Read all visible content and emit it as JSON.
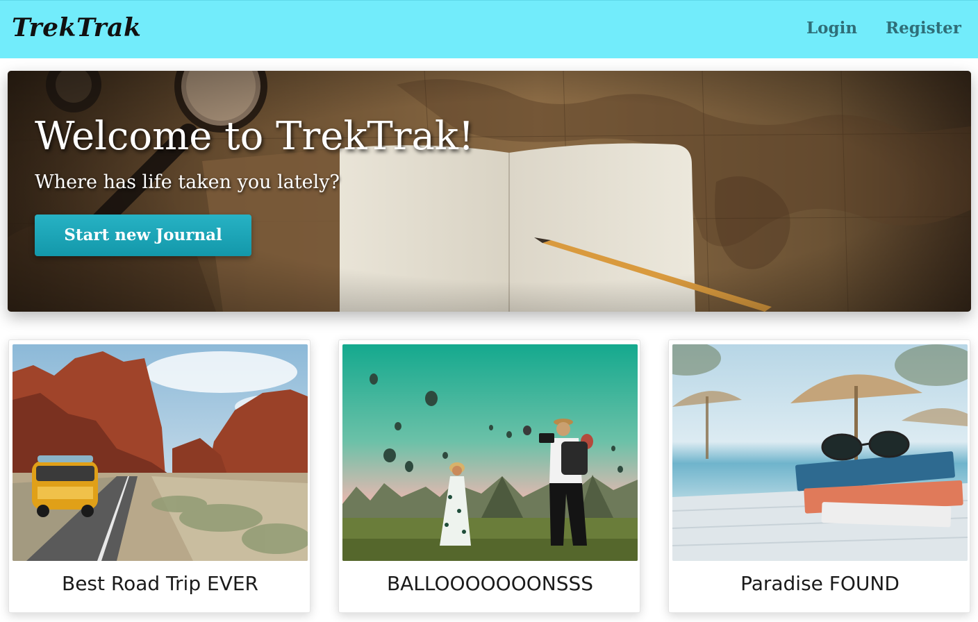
{
  "navbar": {
    "brand": "TrekTrak",
    "links": [
      {
        "label": "Login"
      },
      {
        "label": "Register"
      }
    ],
    "background_color": "#72ecfb"
  },
  "hero": {
    "title": "Welcome to TrekTrak!",
    "subtitle": "Where has life taken you lately?",
    "cta_label": "Start new Journal",
    "cta_color": "#1fa8ba"
  },
  "journals": [
    {
      "title": "Best Road Trip EVER",
      "image": "desert-road-van-photo"
    },
    {
      "title": "BALLOOOOOOONSSS",
      "image": "hot-air-balloons-photo"
    },
    {
      "title": "Paradise FOUND",
      "image": "beach-books-sunglasses-photo"
    }
  ]
}
